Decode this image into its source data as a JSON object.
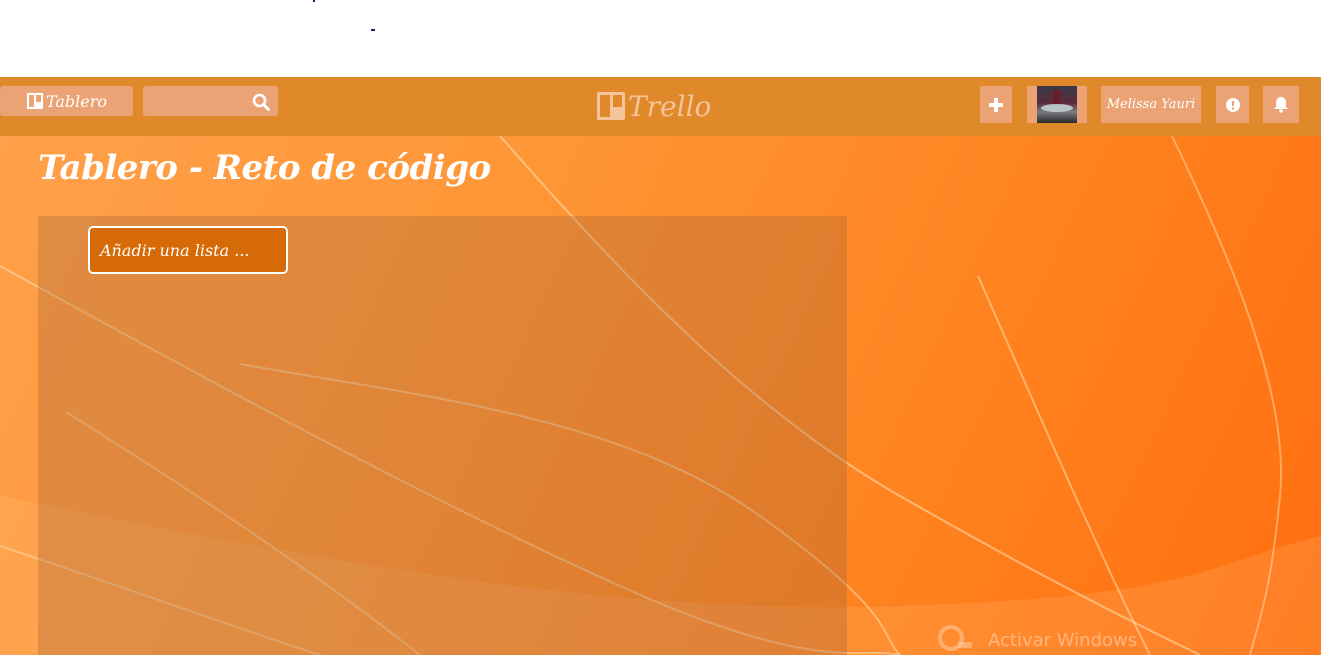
{
  "header": {
    "board_button_label": "Tablero",
    "search_placeholder": "",
    "logo_text": "Trello",
    "user_name": "Melissa Yauri"
  },
  "board": {
    "title": "Tablero - Reto de código",
    "add_list_label": "Añadir una lista ..."
  },
  "os_watermark": {
    "text": "Activar Windows"
  },
  "colors": {
    "topbar": "#e0892a",
    "button": "#eba376",
    "add_list_bg": "#d66a06",
    "background_start": "#ffa04a",
    "background_end": "#ff6e0e"
  },
  "icons": [
    "trello-board-icon",
    "search-icon",
    "plus-icon",
    "info-icon",
    "bell-icon"
  ]
}
